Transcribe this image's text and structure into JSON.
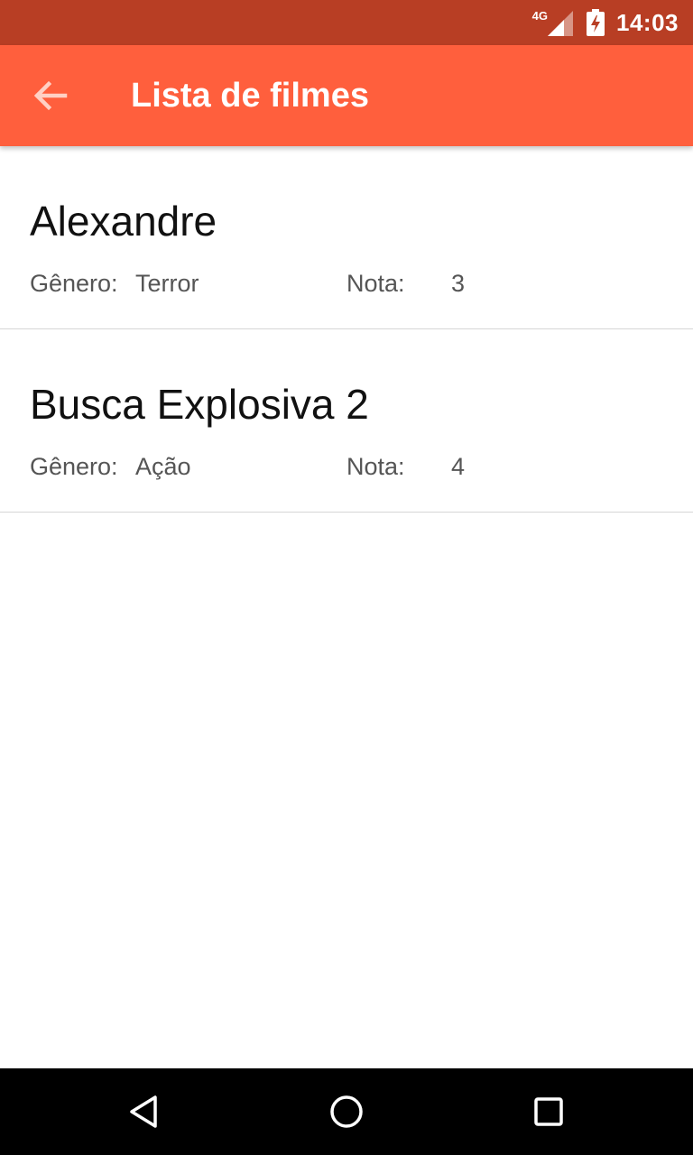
{
  "status_bar": {
    "network": "4G",
    "time": "14:03",
    "icons": [
      "signal-icon",
      "battery-charging-icon"
    ]
  },
  "app_bar": {
    "back_icon": "arrow-back-icon",
    "title": "Lista de filmes",
    "color": "#ff5f3d"
  },
  "movies": [
    {
      "title": "Alexandre",
      "genre_label": "Gênero:",
      "genre": "Terror",
      "rating_label": "Nota:",
      "rating": "3"
    },
    {
      "title": "Busca Explosiva 2",
      "genre_label": "Gênero:",
      "genre": "Ação",
      "rating_label": "Nota:",
      "rating": "4"
    }
  ],
  "nav_bar": {
    "icons": [
      "nav-back-icon",
      "nav-home-icon",
      "nav-recents-icon"
    ]
  }
}
